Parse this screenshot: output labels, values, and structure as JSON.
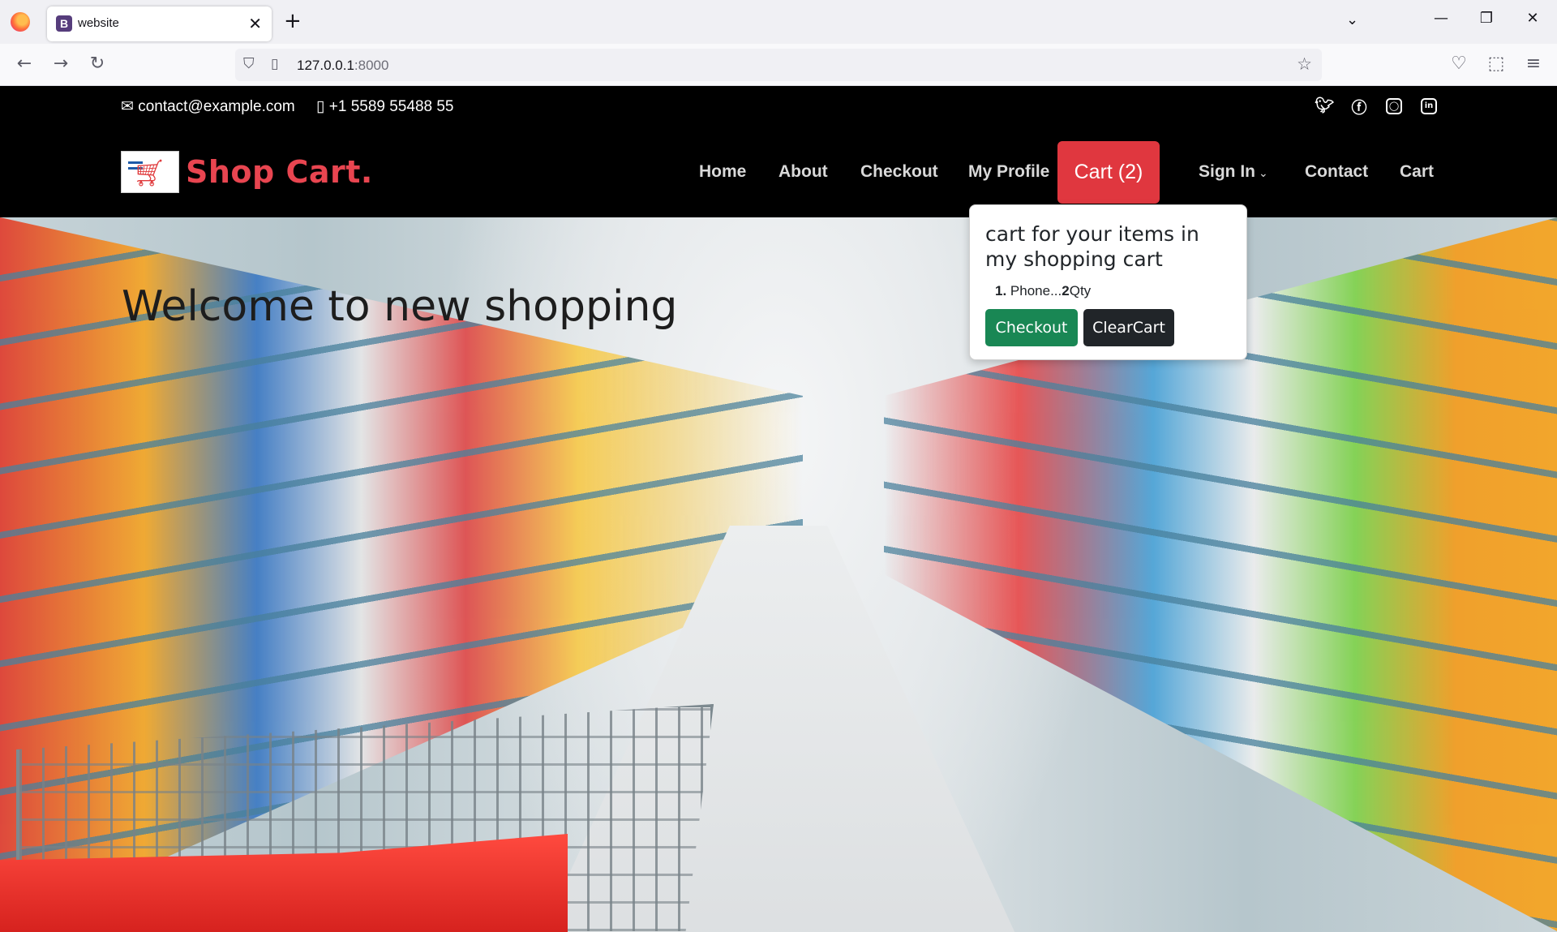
{
  "browser": {
    "tab_title": "website",
    "tab_favicon_letter": "B",
    "url_host": "127.0.0.1",
    "url_port": ":8000"
  },
  "topbar": {
    "email": "contact@example.com",
    "phone": "+1 5589 55488 55",
    "social": [
      "twitter-icon",
      "facebook-icon",
      "instagram-icon",
      "linkedin-icon"
    ]
  },
  "header": {
    "brand": "Shop Cart.",
    "menu": {
      "home": "Home",
      "about": "About",
      "checkout": "Checkout",
      "profile": "My Profile",
      "cart_button": "Cart (2)",
      "signin": "Sign In",
      "contact": "Contact",
      "cart": "Cart"
    }
  },
  "hero": {
    "title": "Welcome to new shopping"
  },
  "popover": {
    "title": "cart for your items in my shopping cart",
    "items": [
      {
        "index": "1.",
        "name": "Phone...",
        "qty": "2",
        "qty_label": "Qty"
      }
    ],
    "checkout_label": "Checkout",
    "clear_label": "ClearCart"
  },
  "colors": {
    "brand": "#e84550",
    "cart_button": "#e0373f",
    "checkout_green": "#198754",
    "clear_dark": "#212529"
  }
}
